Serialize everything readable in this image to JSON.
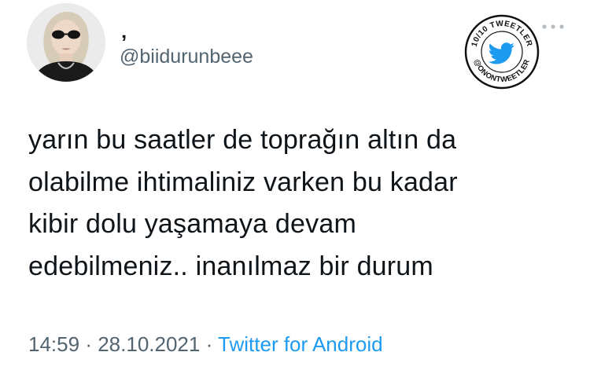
{
  "user": {
    "display_name": "‚",
    "handle": "@biidurunbeee",
    "avatar": "profile-photo"
  },
  "tweet": {
    "lines": [
      "yarın bu saatler de toprağın altın da",
      "olabilme ihtimaliniz varken bu kadar",
      "kibir dolu yaşamaya devam",
      "edebilmeniz.. inanılmaz bir durum"
    ]
  },
  "meta": {
    "time": "14:59",
    "separator": "·",
    "date": "28.10.2021",
    "source": "Twitter for Android"
  },
  "watermark": {
    "top_text": "10/10 TWEETLER",
    "bottom_text": "@ONONTWEETLER",
    "icon": "twitter-bird-icon"
  },
  "menu": {
    "icon": "more-dots-icon"
  },
  "colors": {
    "link": "#1d9bf0",
    "secondary_text": "#536471",
    "primary_text": "#0f1419",
    "twitter_blue": "#1d9bf0"
  }
}
